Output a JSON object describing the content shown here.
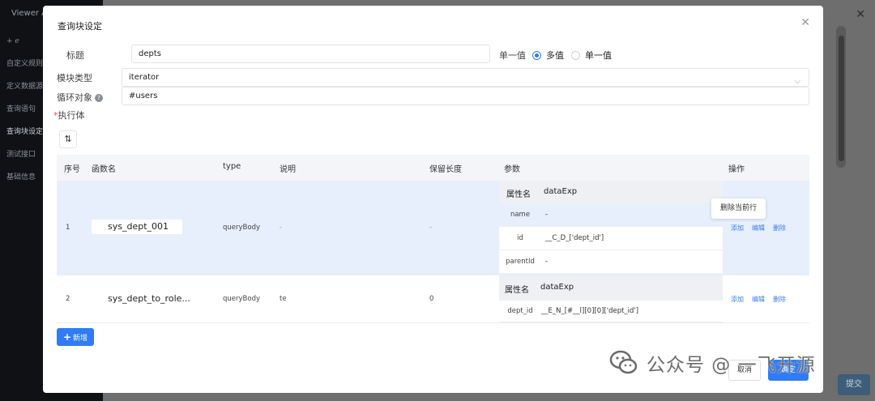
{
  "background": {
    "app_title": "Viewer A",
    "menu": [
      "+ ℯ",
      "自定义规则",
      "定义数据源",
      "查询语句",
      "查询块设定",
      "测试接口",
      "基础信息"
    ],
    "active_menu_index": 4,
    "submit_label": "提交"
  },
  "modal": {
    "title": "查询块设定",
    "fields": {
      "title_label": "标题",
      "title_value": "depts",
      "value_mode_label": "单一值",
      "radio_multi": "多值",
      "radio_single": "单一值",
      "selected": "多值",
      "block_type_label": "模块类型",
      "block_type_value": "iterator",
      "loop_label": "循环对象",
      "loop_value": "#users",
      "body_label": "执行体"
    },
    "table": {
      "headers": [
        "序号",
        "函数名",
        "type",
        "说明",
        "保留长度",
        "参数",
        "操作"
      ],
      "rows": [
        {
          "index": "1",
          "fn": "sys_dept_001",
          "type": "queryBody",
          "desc": "-",
          "keep": "-",
          "param_head_key": "属性名",
          "param_head_val": "dataExp",
          "params": [
            {
              "k": "name",
              "v": "-"
            },
            {
              "k": "id",
              "v": "__C_D_['dept_id']"
            },
            {
              "k": "parentId",
              "v": "-"
            }
          ],
          "ops": [
            "添加",
            "编辑",
            "删除"
          ]
        },
        {
          "index": "2",
          "fn": "sys_dept_to_role...",
          "type": "queryBody",
          "desc": "te",
          "keep": "0",
          "param_head_key": "属性名",
          "param_head_val": "dataExp",
          "params": [
            {
              "k": "dept_id",
              "v": "__E_N_[#__l][0][0]['dept_id']"
            }
          ],
          "ops": [
            "添加",
            "编辑",
            "删除"
          ]
        }
      ]
    },
    "tooltip": "删除当前行",
    "add_button": "新增",
    "cancel_button": "取消",
    "ok_button": "确定"
  },
  "watermark": "公众号 @ 一飞开源",
  "colors": {
    "primary": "#2f7cf6",
    "row_highlight": "#e7effc",
    "header_bg": "#f3f5f8"
  }
}
